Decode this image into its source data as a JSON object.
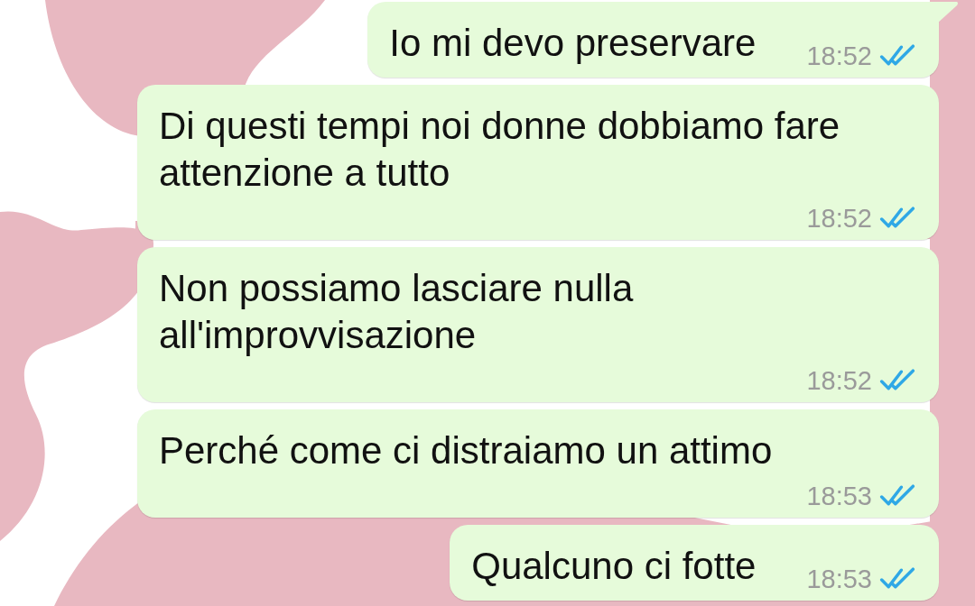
{
  "messages": [
    {
      "text": "Io mi devo preservare",
      "time": "18:52",
      "read": true,
      "tail": true
    },
    {
      "text": "Di questi tempi noi donne dobbiamo fare attenzione a tutto",
      "time": "18:52",
      "read": true,
      "tail": false
    },
    {
      "text": "Non possiamo lasciare nulla all'improvvisazione",
      "time": "18:52",
      "read": true,
      "tail": false
    },
    {
      "text": "Perché come ci distraiamo un attimo",
      "time": "18:53",
      "read": true,
      "tail": false
    },
    {
      "text": "Qualcuno ci fotte",
      "time": "18:53",
      "read": true,
      "tail": false
    }
  ]
}
